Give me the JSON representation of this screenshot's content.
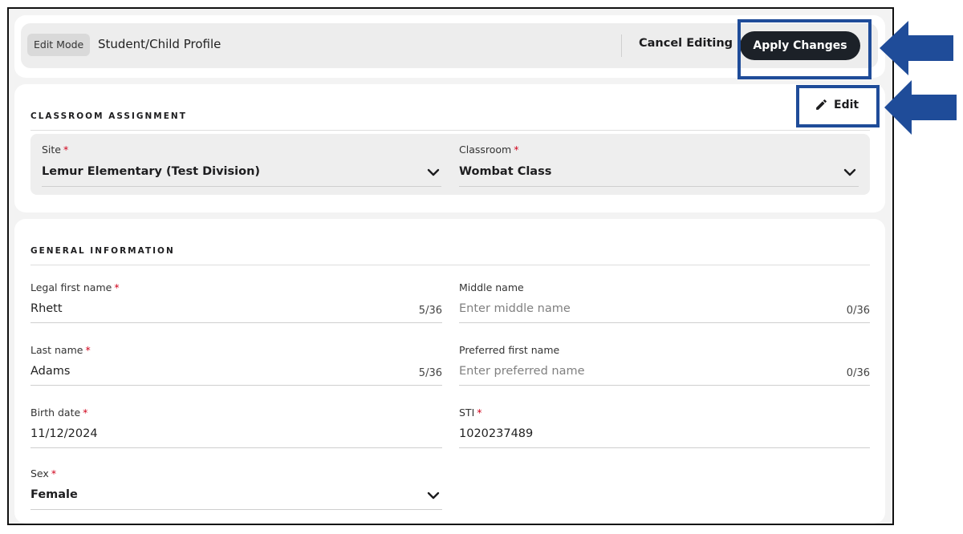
{
  "header": {
    "mode_badge": "Edit Mode",
    "title": "Student/Child Profile",
    "cancel_label": "Cancel Editing",
    "apply_label": "Apply Changes"
  },
  "classroom_assignment": {
    "section_title": "CLASSROOM ASSIGNMENT",
    "edit_label": "Edit",
    "site_label": "Site",
    "site_value": "Lemur Elementary (Test Division)",
    "classroom_label": "Classroom",
    "classroom_value": "Wombat Class",
    "required_mark": "*"
  },
  "general_information": {
    "section_title": "GENERAL INFORMATION",
    "legal_first_name": {
      "label": "Legal first name",
      "value": "Rhett",
      "count": "5/36"
    },
    "middle_name": {
      "label": "Middle name",
      "placeholder": "Enter middle name",
      "count": "0/36"
    },
    "last_name": {
      "label": "Last name",
      "value": "Adams",
      "count": "5/36"
    },
    "preferred_first_name": {
      "label": "Preferred first name",
      "placeholder": "Enter preferred name",
      "count": "0/36"
    },
    "birth_date": {
      "label": "Birth date",
      "value": "11/12/2024"
    },
    "sti": {
      "label": "STI",
      "value": "1020237489"
    },
    "sex": {
      "label": "Sex",
      "value": "Female"
    }
  },
  "colors": {
    "highlight": "#1f4c99",
    "apply_button_bg": "#1c2128",
    "required": "#d0021b"
  },
  "icons": {
    "edit": "pencil-icon",
    "dropdown": "chevron-down-icon",
    "callout": "arrow-left-icon"
  }
}
